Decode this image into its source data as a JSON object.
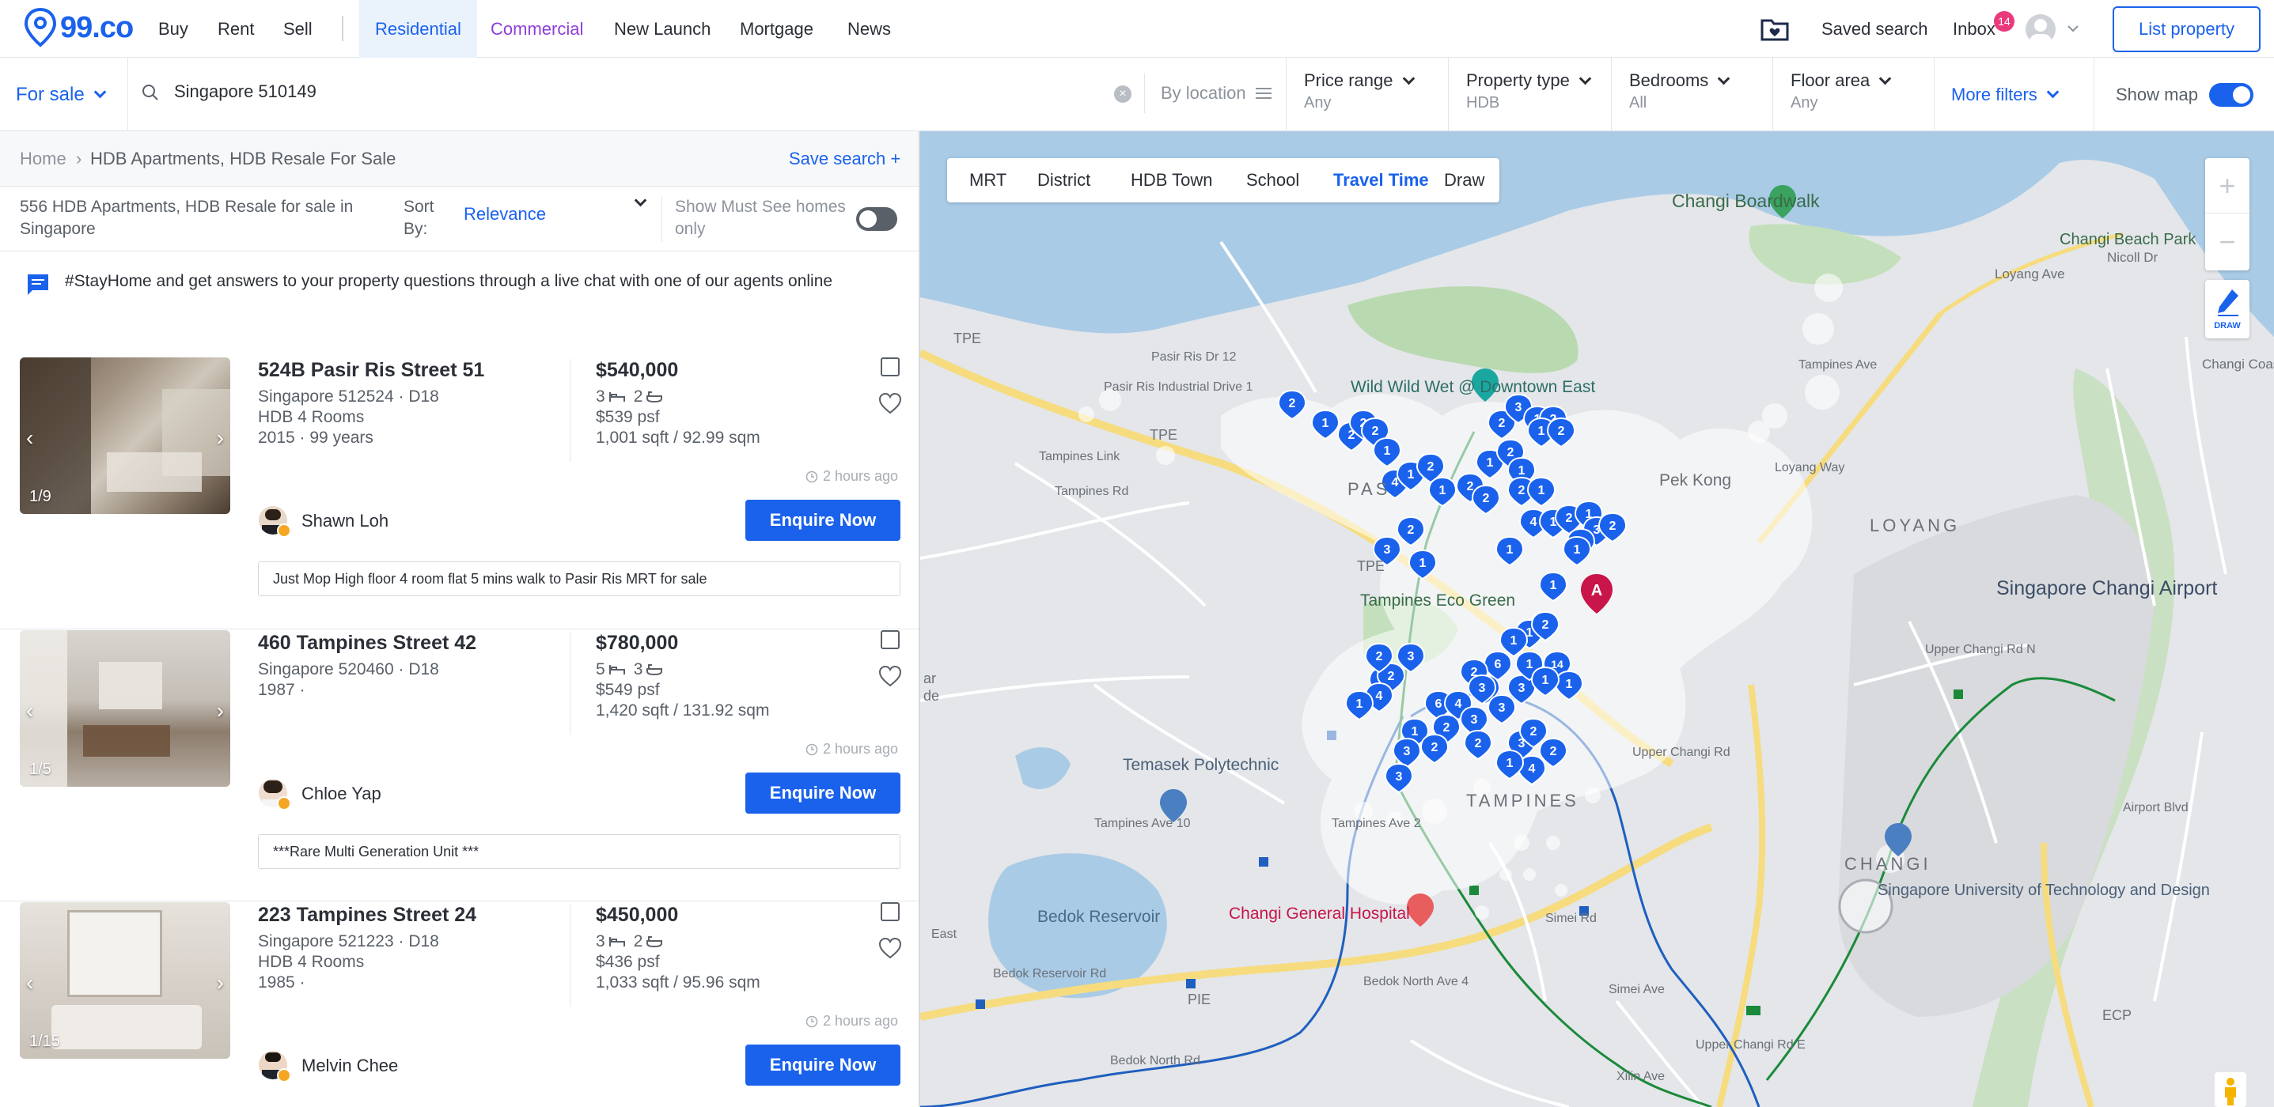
{
  "brand": {
    "logo_text": "99.co",
    "accent": "#1a62ec",
    "commercial_color": "#8e3fd6"
  },
  "nav": {
    "buy": "Buy",
    "rent": "Rent",
    "sell": "Sell",
    "residential": "Residential",
    "commercial": "Commercial",
    "new_launch": "New Launch",
    "mortgage": "Mortgage",
    "news": "News",
    "saved_search": "Saved search",
    "inbox": "Inbox",
    "inbox_count": "14",
    "list_property": "List property"
  },
  "filters": {
    "for_sale": "For sale",
    "search_value": "Singapore 510149",
    "clear_symbol": "×",
    "by_location": "By location",
    "price_label": "Price range",
    "price_value": "Any",
    "type_label": "Property type",
    "type_value": "HDB",
    "bedrooms_label": "Bedrooms",
    "bedrooms_value": "All",
    "floor_label": "Floor area",
    "floor_value": "Any",
    "more": "More filters",
    "show_map": "Show map",
    "show_map_on": true
  },
  "breadcrumb": {
    "home": "Home",
    "separator": "›",
    "current": "HDB Apartments, HDB Resale For Sale",
    "save_search": "Save search +"
  },
  "results": {
    "count_text": "556 HDB Apartments, HDB Resale for sale in Singapore",
    "sort_label": "Sort By:",
    "sort_value": "Relevance",
    "must_see": "Show Must See homes only",
    "must_see_on": false
  },
  "banner": {
    "text": "#StayHome and get answers to your property questions through a live chat with one of our agents online"
  },
  "listings": [
    {
      "title": "524B Pasir Ris Street 51",
      "location": "Singapore 512524 · D18",
      "type": "HDB 4 Rooms",
      "year": "2015 · 99 years",
      "price": "$540,000",
      "beds": "3",
      "baths": "2",
      "psf": "$539 psf",
      "area": "1,001 sqft / 92.99 sqm",
      "photo_count": "1/9",
      "time": "2 hours ago",
      "agent": "Shawn Loh",
      "cta": "Enquire Now",
      "desc": "Just Mop High floor 4 room flat 5 mins walk to Pasir Ris MRT for sale"
    },
    {
      "title": "460 Tampines Street 42",
      "location": "Singapore 520460 · D18",
      "type": "1987 ·",
      "year": "",
      "price": "$780,000",
      "beds": "5",
      "baths": "3",
      "psf": "$549 psf",
      "area": "1,420 sqft / 131.92 sqm",
      "photo_count": "1/5",
      "time": "2 hours ago",
      "agent": "Chloe Yap",
      "cta": "Enquire Now",
      "desc": "***Rare Multi Generation Unit ***"
    },
    {
      "title": "223 Tampines Street 24",
      "location": "Singapore 521223 · D18",
      "type": "HDB 4 Rooms",
      "year": "1985 ·",
      "price": "$450,000",
      "beds": "3",
      "baths": "2",
      "psf": "$436 psf",
      "area": "1,033 sqft / 95.96 sqm",
      "photo_count": "1/15",
      "time": "2 hours ago",
      "agent": "Melvin Chee",
      "cta": "Enquire Now",
      "desc": ""
    }
  ],
  "map": {
    "tabs": [
      "MRT",
      "District",
      "HDB Town",
      "School",
      "Travel Time",
      "Draw"
    ],
    "active_tab": "Travel Time",
    "zoom_in": "+",
    "zoom_out": "−",
    "draw_label": "DRAW",
    "labels": {
      "changi_boardwalk": "Changi Boardwalk",
      "changi_beach_park": "Changi Beach Park",
      "wild_wild_wet": "Wild Wild Wet @ Downtown East",
      "loyang": "LOYANG",
      "pek_kong": "Pek Kong",
      "pasir": "PAS",
      "tampines_eco_green": "Tampines Eco Green",
      "tampines": "TAMPINES",
      "changi_airport": "Singapore Changi Airport",
      "changi": "CHANGI",
      "temasek_poly": "Temasek Polytechnic",
      "bedok_reservoir": "Bedok Reservoir",
      "changi_general_hospital": "Changi General Hospital",
      "sutd": "Singapore University of Technology and Design",
      "tpe": "TPE",
      "pie": "PIE",
      "ecp": "ECP",
      "marker_a": "A",
      "loyang_ave": "Loyang Ave",
      "nicoll_dr": "Nicoll Dr",
      "changi_coast_rd": "Changi Coast Rd",
      "tampines_rd": "Tampines Rd",
      "tampines_link": "Tampines Link",
      "pasir_ris_ind_dr1": "Pasir Ris Industrial Drive 1",
      "upper_changi_rd_n": "Upper Changi Rd N",
      "upper_changi_rd_e": "Upper Changi Rd E",
      "simei_ave": "Simei Ave",
      "xilin_ave": "Xilin Ave",
      "tampines_ave10": "Tampines Ave 10",
      "bedok_north_rd": "Bedok North Rd",
      "airport_blvd": "Airport Blvd",
      "loyang_way": "Loyang Way",
      "upper_changi_rd": "Upper Changi Rd",
      "pasir_ris_dr12": "Pasir Ris Dr 12",
      "tampines_ave2": "Tampines Ave 2",
      "simei_rd": "Simei Rd",
      "bedok_reservoir_rd": "Bedok Reservoir Rd",
      "bedok_north_ave4": "Bedok North Ave 4",
      "tampines_ave": "Tampines Ave",
      "bedok_east": "East",
      "jalan": "ar",
      "jalan2": "de"
    },
    "pins": [
      "2",
      "1",
      "2",
      "2",
      "2",
      "1",
      "4",
      "1",
      "2",
      "1",
      "2",
      "2",
      "1",
      "2",
      "1",
      "2",
      "3",
      "1",
      "2",
      "1",
      "2",
      "2",
      "1",
      "4",
      "1",
      "2",
      "1",
      "3",
      "1",
      "2",
      "1",
      "1",
      "6",
      "4",
      "2",
      "1",
      "3",
      "3",
      "14",
      "1",
      "1",
      "2",
      "1",
      "6",
      "2",
      "3",
      "1",
      "1",
      "3",
      "2",
      "4",
      "2",
      "4",
      "1",
      "3",
      "2",
      "1",
      "3",
      "2",
      "3",
      "3",
      "4",
      "2",
      "1",
      "2",
      "3",
      "2",
      "1",
      "1"
    ]
  }
}
